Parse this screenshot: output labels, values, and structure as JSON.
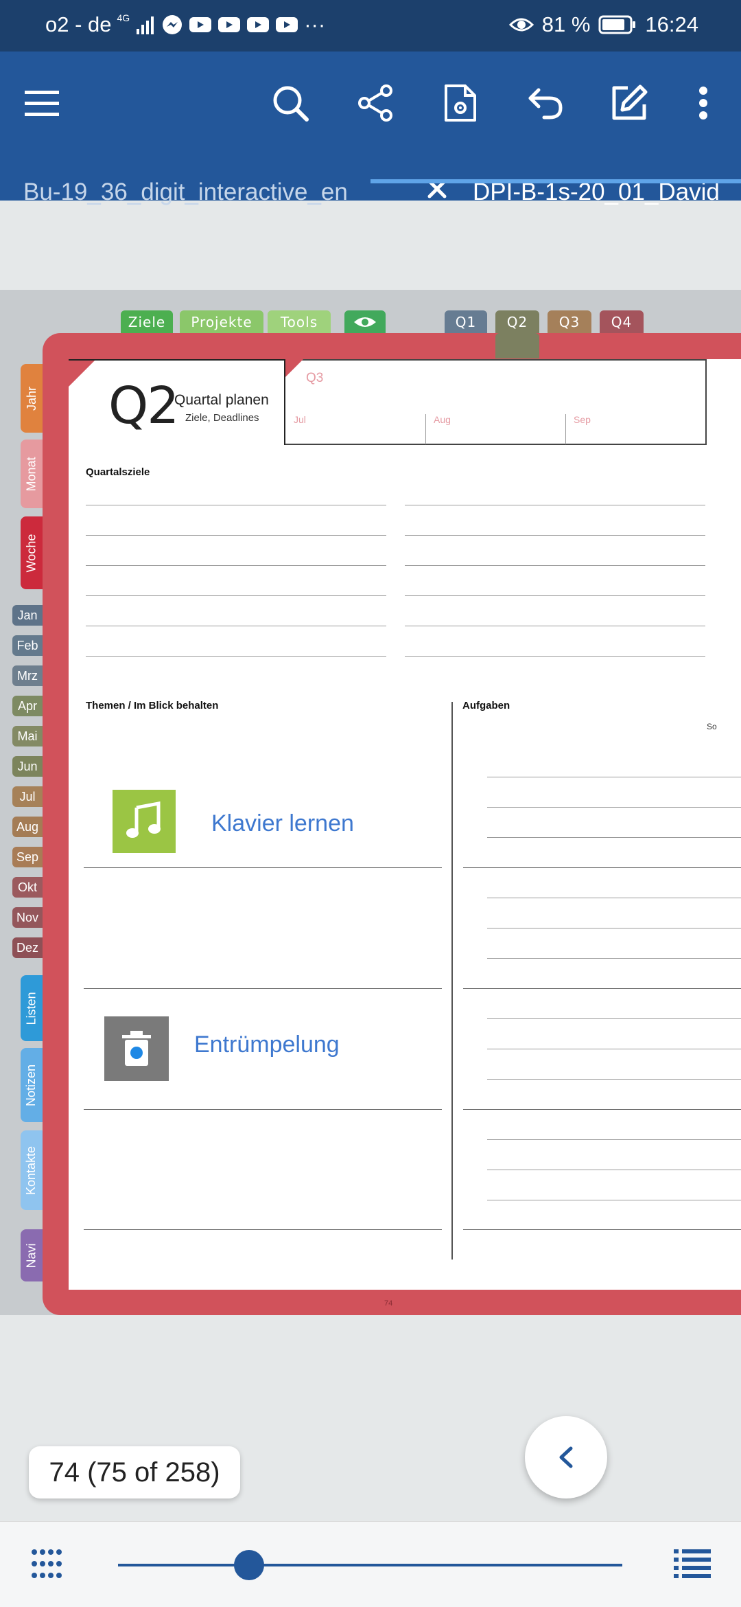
{
  "status_bar": {
    "carrier": "o2 - de",
    "network": "4G",
    "more": "···",
    "battery": "81 %",
    "time": "16:24"
  },
  "tabs": [
    {
      "label": "Bu-19_36_digit_interactive_en",
      "active": false
    },
    {
      "label": "DPI-B-1s-20_01_David",
      "active": true
    }
  ],
  "planner": {
    "top_tabs": [
      "Ziele",
      "Projekte",
      "Tools",
      "Q1",
      "Q2",
      "Q3",
      "Q4"
    ],
    "side_tabs": [
      "Jahr",
      "Monat",
      "Woche",
      "Listen",
      "Notizen",
      "Kontakte",
      "Navi"
    ],
    "months": [
      "Jan",
      "Feb",
      "Mrz",
      "Apr",
      "Mai",
      "Jun",
      "Jul",
      "Aug",
      "Sep",
      "Okt",
      "Nov",
      "Dez"
    ],
    "quarter": "Q2",
    "quarter_title": "Quartal planen",
    "quarter_subtitle": "Ziele, Deadlines",
    "next_quarter": "Q3",
    "next_months": [
      "Jul",
      "Aug",
      "Sep"
    ],
    "goals_heading": "Quartalsziele",
    "themes_heading": "Themen / Im Blick behalten",
    "tasks_heading": "Aufgaben",
    "day_label": "So",
    "themes": [
      "Klavier lernen",
      "Entrümpelung"
    ],
    "page_number": "74"
  },
  "page_indicator": "74 (75 of 258)",
  "slider_position": 0.26,
  "colors": {
    "status_bar": "#1c406c",
    "app_bar": "#23579a",
    "cover": "#d1525b",
    "link_text": "#3e78cf"
  }
}
